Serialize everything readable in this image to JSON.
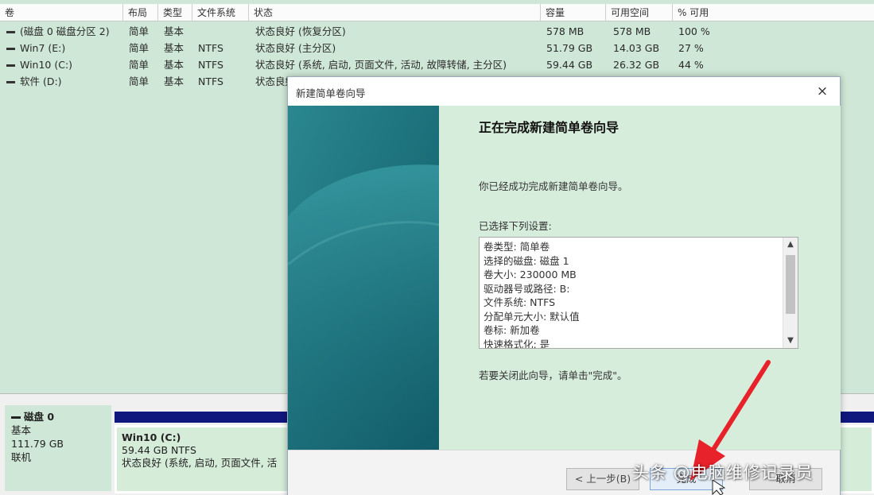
{
  "volume_list": {
    "columns": [
      "卷",
      "布局",
      "类型",
      "文件系统",
      "状态",
      "容量",
      "可用空间",
      "% 可用"
    ],
    "rows": [
      {
        "volume": "(磁盘 0 磁盘分区 2)",
        "layout": "简单",
        "type": "基本",
        "fs": "",
        "status": "状态良好 (恢复分区)",
        "capacity": "578 MB",
        "free": "578 MB",
        "pct": "100 %"
      },
      {
        "volume": "Win7 (E:)",
        "layout": "简单",
        "type": "基本",
        "fs": "NTFS",
        "status": "状态良好 (主分区)",
        "capacity": "51.79 GB",
        "free": "14.03 GB",
        "pct": "27 %"
      },
      {
        "volume": "Win10 (C:)",
        "layout": "简单",
        "type": "基本",
        "fs": "NTFS",
        "status": "状态良好 (系统, 启动, 页面文件, 活动, 故障转储, 主分区)",
        "capacity": "59.44 GB",
        "free": "26.32 GB",
        "pct": "44 %"
      },
      {
        "volume": "软件 (D:)",
        "layout": "简单",
        "type": "基本",
        "fs": "NTFS",
        "status": "状态良好",
        "capacity": "",
        "free": "",
        "pct": ""
      }
    ]
  },
  "disk_map": {
    "disk_name": "磁盘 0",
    "disk_type": "基本",
    "disk_size": "111.79 GB",
    "disk_status": "联机",
    "partition": {
      "name": "Win10  (C:)",
      "size_fs": "59.44 GB NTFS",
      "status": "状态良好 (系统, 启动, 页面文件, 活"
    },
    "partition_bar_color": "#10177d"
  },
  "dialog": {
    "title": "新建简单卷向导",
    "close_glyph": "×",
    "heading": "正在完成新建简单卷向导",
    "success_text": "你已经成功完成新建简单卷向导。",
    "settings_label": "已选择下列设置:",
    "settings": [
      "卷类型: 简单卷",
      "选择的磁盘: 磁盘 1",
      "卷大小: 230000 MB",
      "驱动器号或路径: B:",
      "文件系统: NTFS",
      "分配单元大小: 默认值",
      "卷标: 新加卷",
      "快速格式化: 是"
    ],
    "close_hint": "若要关闭此向导，请单击\"完成\"。",
    "buttons": {
      "back": "< 上一步(B)",
      "finish": "完成",
      "cancel": "取消"
    },
    "sidebar_color": "#1c6f7a"
  },
  "watermark": "头条 @电脑维修记录员",
  "annotation_arrow_color": "#e8222a"
}
